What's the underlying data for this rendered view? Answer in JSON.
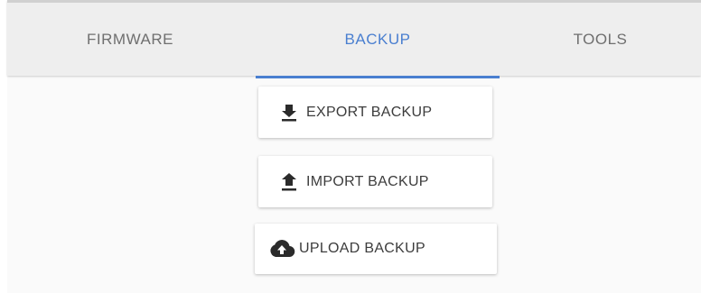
{
  "tabs": {
    "firmware": "FIRMWARE",
    "backup": "BACKUP",
    "tools": "TOOLS",
    "active": "BACKUP"
  },
  "actions": {
    "export_label": "EXPORT BACKUP",
    "export_icon": "download-icon",
    "import_label": "IMPORT BACKUP",
    "import_icon": "upload-arrow-icon",
    "upload_label": "UPLOAD BACKUP",
    "upload_icon": "cloud-upload-icon"
  },
  "colors": {
    "accent": "#4a7fd0",
    "tab_text": "#6f6f6f",
    "tab_bar_bg": "#eeeeee",
    "button_text": "#3c3c3c"
  }
}
